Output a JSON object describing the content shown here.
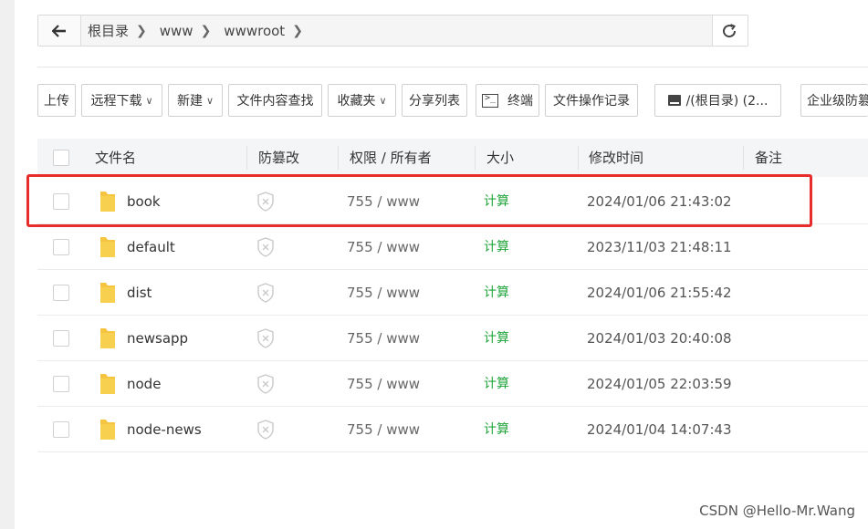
{
  "breadcrumb": {
    "items": [
      "根目录",
      "www",
      "wwwroot"
    ]
  },
  "toolbar": {
    "upload": "上传",
    "remote_download": "远程下载",
    "new": "新建",
    "content_search": "文件内容查找",
    "favorites": "收藏夹",
    "share_list": "分享列表",
    "terminal": "终端",
    "op_log": "文件操作记录",
    "disk": "/(根目录) (2...",
    "enterprise": "企业级防篡"
  },
  "table": {
    "columns": [
      "文件名",
      "防篡改",
      "权限 / 所有者",
      "大小",
      "修改时间",
      "备注"
    ],
    "rows": [
      {
        "name": "book",
        "perm": "755 / www",
        "size": "计算",
        "mtime": "2024/01/06 21:43:02"
      },
      {
        "name": "default",
        "perm": "755 / www",
        "size": "计算",
        "mtime": "2023/11/03 21:48:11"
      },
      {
        "name": "dist",
        "perm": "755 / www",
        "size": "计算",
        "mtime": "2024/01/06 21:55:42"
      },
      {
        "name": "newsapp",
        "perm": "755 / www",
        "size": "计算",
        "mtime": "2024/01/03 20:40:08"
      },
      {
        "name": "node",
        "perm": "755 / www",
        "size": "计算",
        "mtime": "2024/01/05 22:03:59"
      },
      {
        "name": "node-news",
        "perm": "755 / www",
        "size": "计算",
        "mtime": "2024/01/04 14:07:43"
      }
    ]
  },
  "colors": {
    "accent_green": "#20a53a",
    "highlight_red": "#e82c2c",
    "folder_yellow": "#f5c542"
  },
  "watermark": "CSDN @Hello-Mr.Wang"
}
